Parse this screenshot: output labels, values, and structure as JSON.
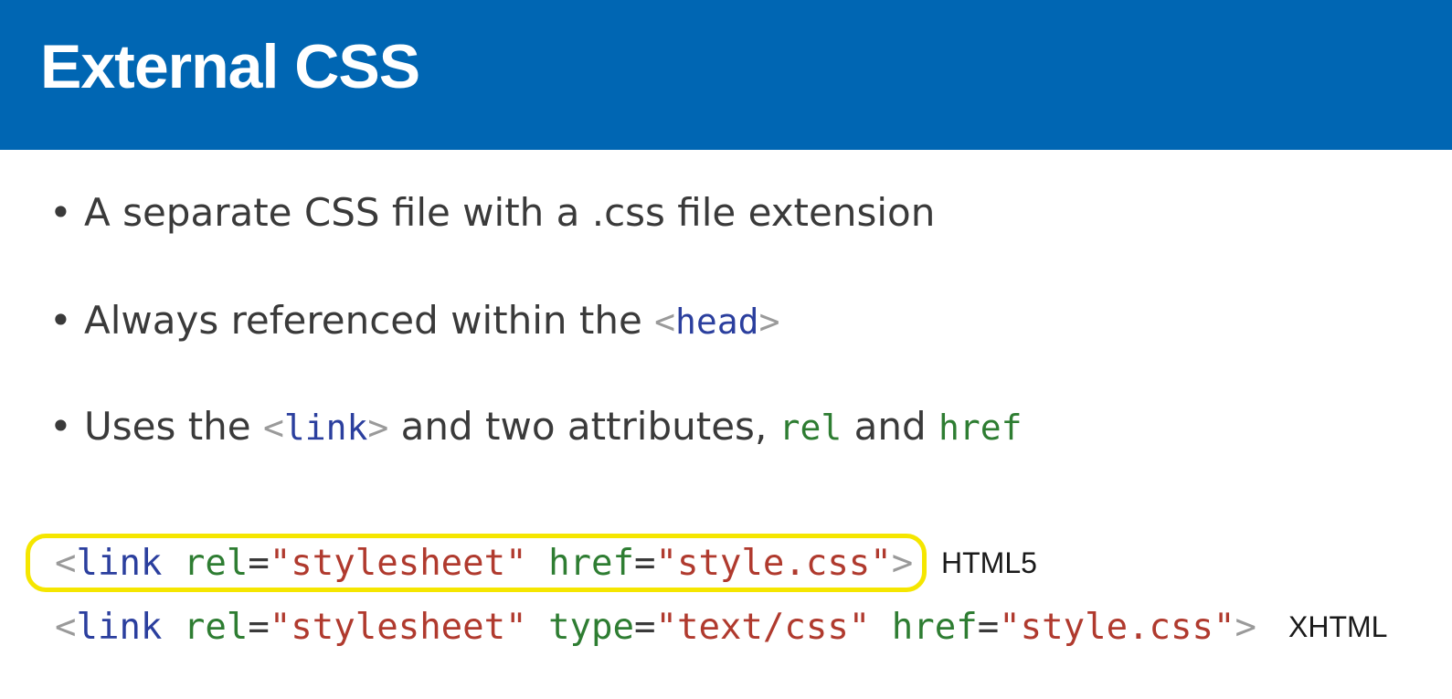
{
  "title": "External CSS",
  "bullets": {
    "b1": "A separate CSS file with a .css file extension",
    "b2_text": "Always referenced within the ",
    "b2_tag": "head",
    "b3_pre": "Uses the ",
    "b3_tag": "link",
    "b3_mid": " and two attributes, ",
    "b3_attr1": "rel",
    "b3_and": " and ",
    "b3_attr2": "href"
  },
  "code": {
    "line1": {
      "tag": "link",
      "rel_attr": "rel",
      "rel_val": "\"stylesheet\"",
      "href_attr": "href",
      "href_val": "\"style.css\"",
      "label": "HTML5"
    },
    "line2": {
      "tag": "link",
      "rel_attr": "rel",
      "rel_val": "\"stylesheet\"",
      "type_attr": "type",
      "type_val": "\"text/css\"",
      "href_attr": "href",
      "href_val": "\"style.css\"",
      "label": "XHTML"
    }
  },
  "symbols": {
    "bullet": "•",
    "lt": "<",
    "gt": ">",
    "eq": "="
  },
  "colors": {
    "header_bg": "#0066b3",
    "highlight": "#f5e600",
    "tag": "#2b3f9e",
    "attr": "#2e7d32",
    "string": "#b03a2e"
  }
}
